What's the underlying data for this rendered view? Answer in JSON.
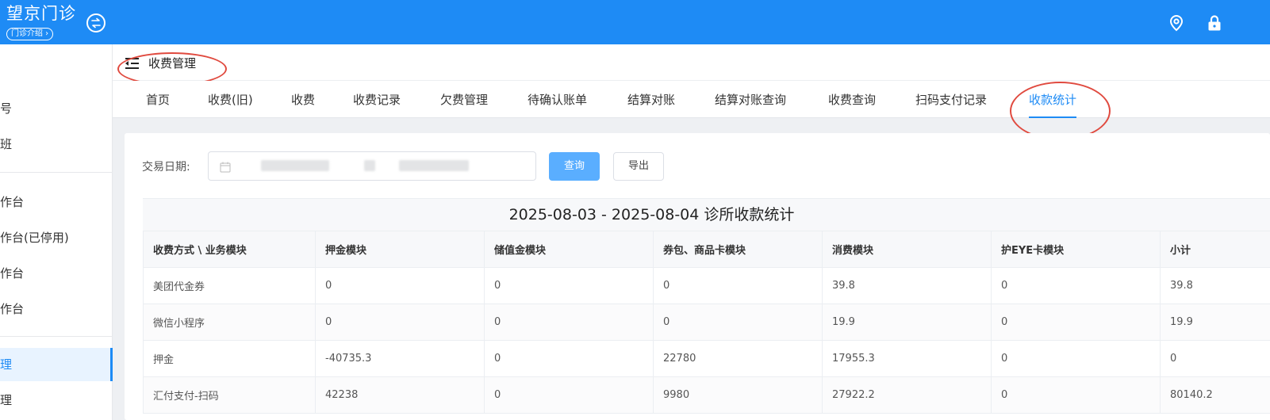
{
  "app": {
    "name": "望京门诊",
    "tag": "门诊介绍 ›"
  },
  "colors": {
    "primary": "#1e8bf5",
    "annotation": "#e04a3f",
    "button_query": "#5aaeff"
  },
  "icons": {
    "swap": "swap-circle-icon",
    "location": "location-pin-icon",
    "lock": "lock-icon",
    "fold": "menu-fold-icon",
    "calendar": "calendar-icon"
  },
  "sidebar": {
    "items": [
      {
        "label": "号"
      },
      {
        "label": "班"
      },
      {
        "label": "作台"
      },
      {
        "label": "作台(已停用)"
      },
      {
        "label": "作台"
      },
      {
        "label": "作台"
      },
      {
        "label": "理"
      },
      {
        "label": "理"
      }
    ]
  },
  "header": {
    "title": "收费管理"
  },
  "tabs": [
    {
      "label": "首页"
    },
    {
      "label": "收费(旧)"
    },
    {
      "label": "收费"
    },
    {
      "label": "收费记录"
    },
    {
      "label": "欠费管理"
    },
    {
      "label": "待确认账单"
    },
    {
      "label": "结算对账"
    },
    {
      "label": "结算对账查询"
    },
    {
      "label": "收费查询"
    },
    {
      "label": "扫码支付记录"
    },
    {
      "label": "收款统计"
    }
  ],
  "filter": {
    "label": "交易日期:",
    "query_label": "查询",
    "export_label": "导出"
  },
  "table": {
    "title": "2025-08-03 - 2025-08-04 诊所收款统计",
    "headers": [
      "收费方式 \\ 业务模块",
      "押金模块",
      "储值金模块",
      "券包、商品卡模块",
      "消费模块",
      "护EYE卡模块",
      "小计"
    ],
    "rows": [
      [
        "美团代金券",
        "0",
        "0",
        "0",
        "39.8",
        "0",
        "39.8"
      ],
      [
        "微信小程序",
        "0",
        "0",
        "0",
        "19.9",
        "0",
        "19.9"
      ],
      [
        "押金",
        "-40735.3",
        "0",
        "22780",
        "17955.3",
        "0",
        "0"
      ],
      [
        "汇付支付-扫码",
        "42238",
        "0",
        "9980",
        "27922.2",
        "0",
        "80140.2"
      ]
    ]
  }
}
